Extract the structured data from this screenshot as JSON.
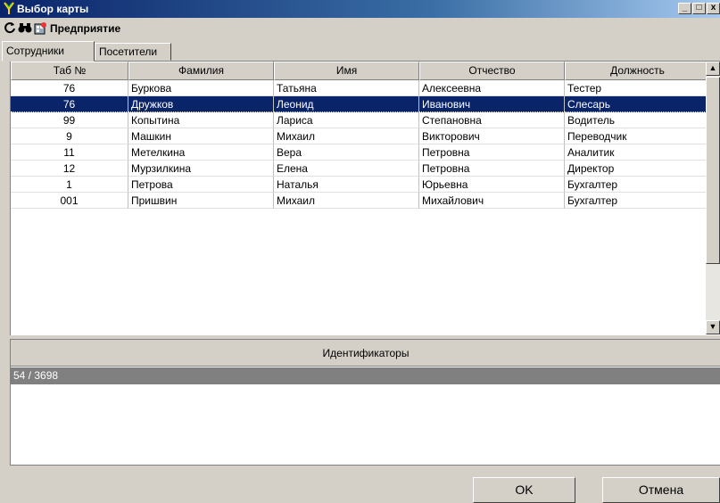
{
  "window": {
    "title": "Выбор карты",
    "minimize": "_",
    "maximize": "□",
    "close": "x"
  },
  "toolbar": {
    "org_label": "Предприятие",
    "refresh_icon": "refresh-icon",
    "find_icon": "binoculars-icon",
    "org_icon": "organization-icon"
  },
  "tabs": [
    {
      "label": "Сотрудники"
    },
    {
      "label": "Посетители"
    }
  ],
  "table": {
    "columns": [
      "Таб №",
      "Фамилия",
      "Имя",
      "Отчество",
      "Должность"
    ],
    "rows": [
      [
        "76",
        "Буркова",
        "Татьяна",
        "Алексеевна",
        "Тестер"
      ],
      [
        "76",
        "Дружков",
        "Леонид",
        "Иванович",
        "Слесарь"
      ],
      [
        "99",
        "Копытина",
        "Лариса",
        "Степановна",
        "Водитель"
      ],
      [
        "9",
        "Машкин",
        "Михаил",
        "Викторович",
        "Переводчик"
      ],
      [
        "11",
        "Метелкина",
        "Вера",
        "Петровна",
        "Аналитик"
      ],
      [
        "12",
        "Мурзилкина",
        "Елена",
        "Петровна",
        "Директор"
      ],
      [
        "1",
        "Петрова",
        "Наталья",
        "Юрьевна",
        "Бухгалтер"
      ],
      [
        "001",
        "Пришвин",
        "Михаил",
        "Михайлович",
        "Бухгалтер"
      ]
    ],
    "selected_row": 1
  },
  "identifiers": {
    "header": "Идентификаторы",
    "counter": "54 / 3698"
  },
  "buttons": {
    "ok": "OK",
    "cancel": "Отмена"
  },
  "colors": {
    "selection": "#0a246a",
    "title_start": "#0a246a",
    "title_end": "#a6caf0"
  }
}
